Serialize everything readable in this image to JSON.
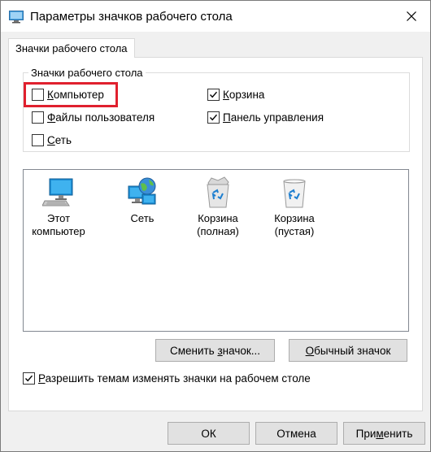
{
  "window": {
    "title": "Параметры значков рабочего стола"
  },
  "tab": {
    "label": "Значки рабочего стола"
  },
  "group": {
    "legend": "Значки рабочего стола",
    "checks": [
      {
        "label_pre": "",
        "label_ul": "К",
        "label_post": "омпьютер",
        "checked": false
      },
      {
        "label_pre": "",
        "label_ul": "К",
        "label_post": "орзина",
        "checked": true
      },
      {
        "label_pre": "",
        "label_ul": "Ф",
        "label_post": "айлы пользователя",
        "checked": false
      },
      {
        "label_pre": "",
        "label_ul": "П",
        "label_post": "анель управления",
        "checked": true
      },
      {
        "label_pre": "",
        "label_ul": "С",
        "label_post": "еть",
        "checked": false
      }
    ]
  },
  "icons": [
    {
      "line1": "Этот",
      "line2": "компьютер",
      "icon": "computer-icon"
    },
    {
      "line1": "Сеть",
      "line2": "",
      "icon": "network-icon"
    },
    {
      "line1": "Корзина",
      "line2": "(полная)",
      "icon": "recycle-bin-full-icon"
    },
    {
      "line1": "Корзина",
      "line2": "(пустая)",
      "icon": "recycle-bin-empty-icon"
    }
  ],
  "buttons": {
    "change_icon_pre": "Сменить ",
    "change_icon_ul": "з",
    "change_icon_post": "начок...",
    "default_icon_pre": "",
    "default_icon_ul": "О",
    "default_icon_post": "бычный значок",
    "ok": "ОК",
    "cancel": "Отмена",
    "apply_pre": "При",
    "apply_ul": "м",
    "apply_post": "енить"
  },
  "themes_check": {
    "label_ul": "Р",
    "label_post": "азрешить темам изменять значки на рабочем столе",
    "checked": true
  },
  "colors": {
    "highlight": "#e0202e",
    "monitor_blue": "#1e90d6"
  }
}
